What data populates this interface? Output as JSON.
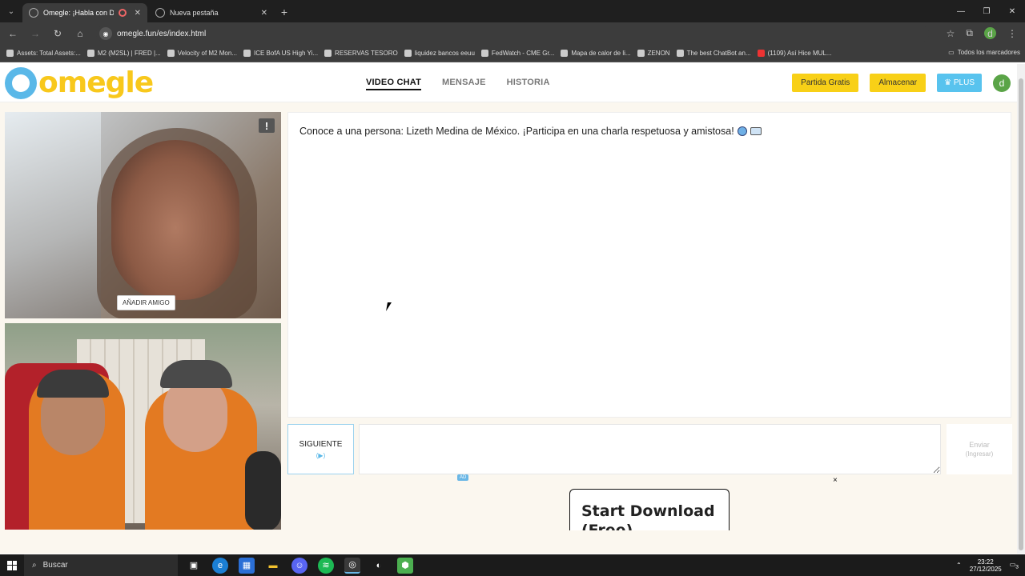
{
  "browser": {
    "tabs": [
      {
        "title": "Omegle: ¡Habla con Desconocidos!",
        "active": true
      },
      {
        "title": "Nueva pestaña",
        "active": false
      }
    ],
    "url": "omegle.fun/es/index.html",
    "bookmarks": [
      "Assets: Total Assets:...",
      "M2 (M2SL) | FRED |...",
      "Velocity of M2 Mon...",
      "ICE BofA US High Yi...",
      "RESERVAS TESORO",
      "liquidez bancos eeuu",
      "FedWatch - CME Gr...",
      "Mapa de calor de li...",
      "ZENON",
      "The best ChatBot an...",
      "(1109) Así Hice MUL..."
    ],
    "all_bookmarks": "Todos los marcadores",
    "profile_initial": "d"
  },
  "site": {
    "logo_text": "omegle",
    "nav": [
      {
        "label": "VIDEO CHAT",
        "active": true
      },
      {
        "label": "MENSAJE",
        "active": false
      },
      {
        "label": "HISTORIA",
        "active": false
      }
    ],
    "buttons": {
      "free_match": "Partida Gratis",
      "store": "Almacenar",
      "plus": "♛ PLUS"
    },
    "avatar_initial": "d"
  },
  "video": {
    "add_friend": "AÑADIR AMIGO",
    "report_icon": "!"
  },
  "chat": {
    "intro": "Conoce a una persona: Lizeth Medina de México. ¡Participa en una charla respetuosa y amistosa!",
    "next_label": "SIGUIENTE",
    "next_key": "(▶)",
    "send_label": "Enviar",
    "send_sub": "(Ingresar)",
    "message_placeholder": ""
  },
  "ad": {
    "badge": "AD",
    "close": "×",
    "line1": "Start Download",
    "line2": "(Free)"
  },
  "taskbar": {
    "search_label": "Buscar",
    "time": "23:22",
    "date": "27/12/2025",
    "notification_count": "3"
  },
  "colors": {
    "brand_yellow": "#f8c81c",
    "brand_blue": "#5ab8e8"
  }
}
